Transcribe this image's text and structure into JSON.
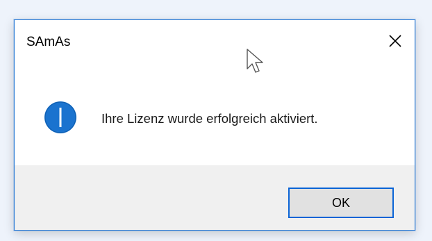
{
  "dialog": {
    "title": "SAmAs",
    "message": "Ihre Lizenz wurde erfolgreich aktiviert.",
    "ok_label": "OK",
    "icon": "info-icon",
    "close_icon": "close-icon"
  },
  "colors": {
    "accent": "#0a64d6",
    "info_icon": "#1a73cf",
    "footer_background": "#f0f0f0",
    "window_border": "#2b7bd6"
  }
}
